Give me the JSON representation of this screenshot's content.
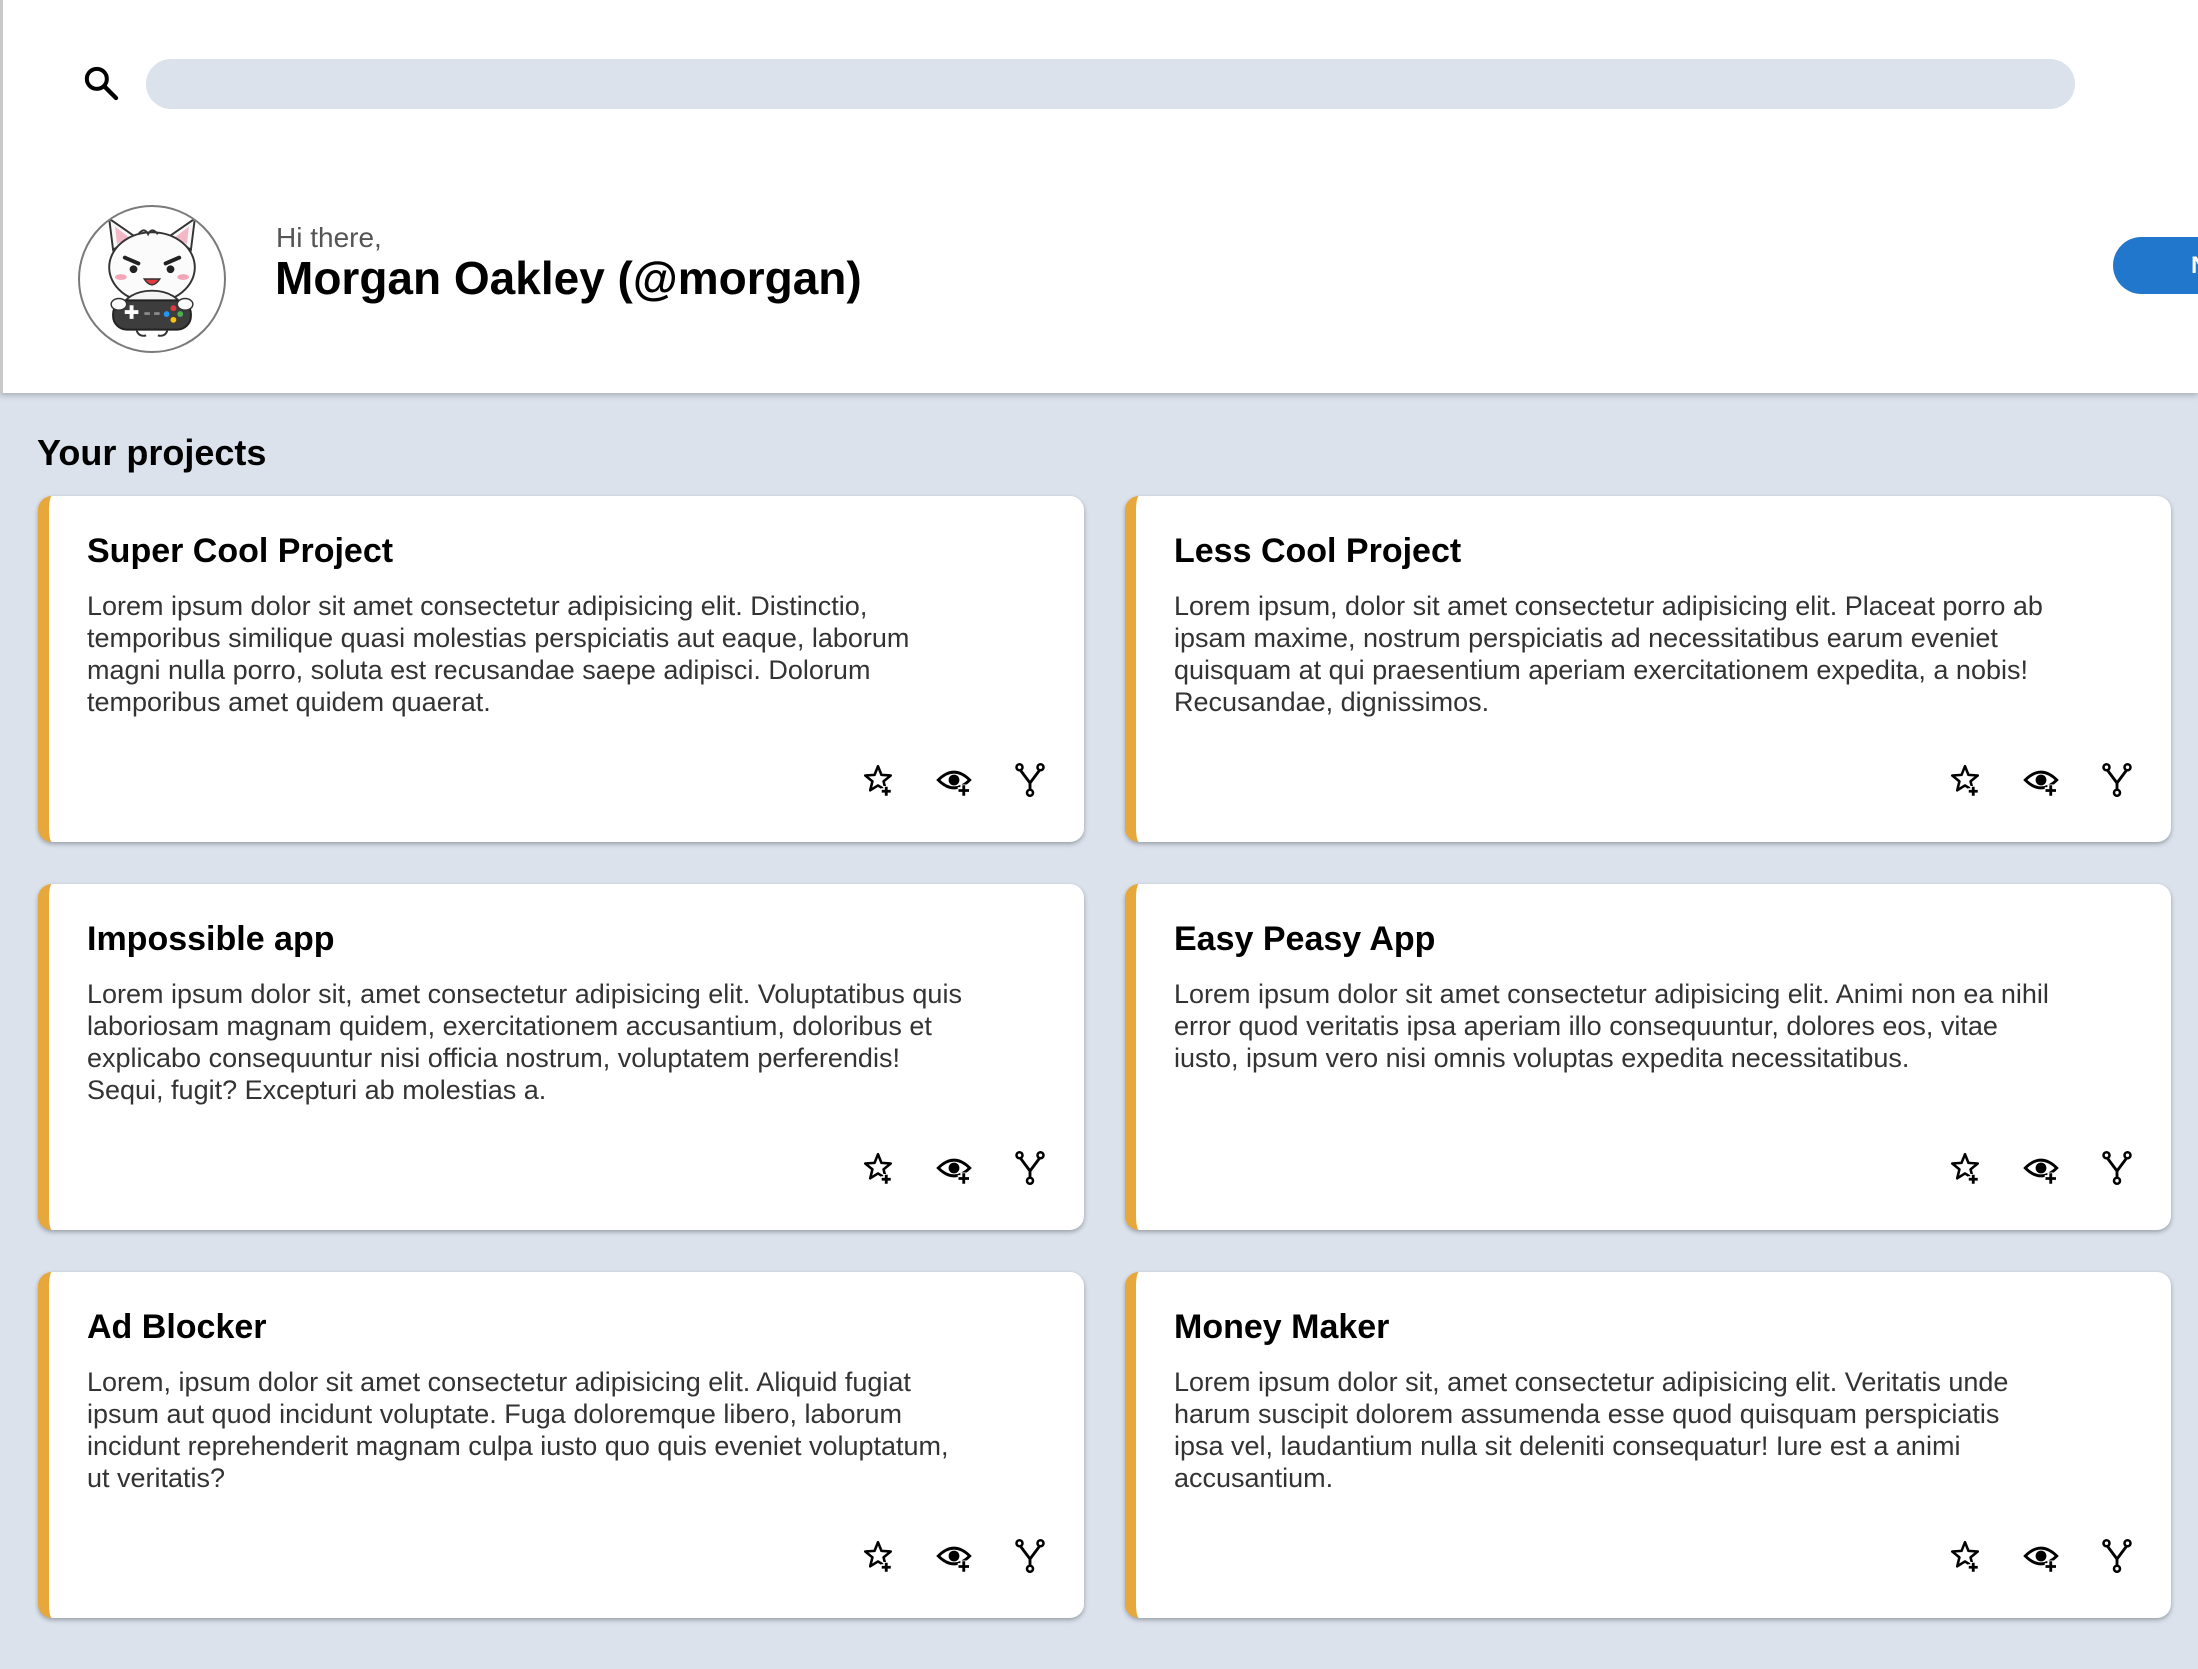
{
  "search": {
    "placeholder": "",
    "value": ""
  },
  "profile": {
    "greeting": "Hi there,",
    "name": "Morgan Oakley (@morgan)"
  },
  "header": {
    "button_label": "N"
  },
  "projects_heading": "Your projects",
  "colors": {
    "accent": "#e8a73a",
    "page_bg": "#dbe2ec",
    "button_blue": "#2177cc"
  },
  "icons": [
    "search-icon",
    "star-plus-icon",
    "eye-plus-icon",
    "fork-icon"
  ],
  "projects": [
    {
      "title": "Super Cool Project",
      "description": "Lorem ipsum dolor sit amet consectetur adipisicing elit. Distinctio, temporibus similique quasi molestias perspiciatis aut eaque, laborum magni nulla porro, soluta est recusandae saepe adipisci. Dolorum temporibus amet quidem quaerat."
    },
    {
      "title": "Less Cool Project",
      "description": "Lorem ipsum, dolor sit amet consectetur adipisicing elit. Placeat porro ab ipsam maxime, nostrum perspiciatis ad necessitatibus earum eveniet quisquam at qui praesentium aperiam exercitationem expedita, a nobis! Recusandae, dignissimos."
    },
    {
      "title": "Impossible app",
      "description": "Lorem ipsum dolor sit, amet consectetur adipisicing elit. Voluptatibus quis laboriosam magnam quidem, exercitationem accusantium, doloribus et explicabo consequuntur nisi officia nostrum, voluptatem perferendis! Sequi, fugit? Excepturi ab molestias a."
    },
    {
      "title": "Easy Peasy App",
      "description": "Lorem ipsum dolor sit amet consectetur adipisicing elit. Animi non ea nihil error quod veritatis ipsa aperiam illo consequuntur, dolores eos, vitae iusto, ipsum vero nisi omnis voluptas expedita necessitatibus."
    },
    {
      "title": "Ad Blocker",
      "description": "Lorem, ipsum dolor sit amet consectetur adipisicing elit. Aliquid fugiat ipsum aut quod incidunt voluptate. Fuga doloremque libero, laborum incidunt reprehenderit magnam culpa iusto quo quis eveniet voluptatum, ut veritatis?"
    },
    {
      "title": "Money Maker",
      "description": "Lorem ipsum dolor sit, amet consectetur adipisicing elit. Veritatis unde harum suscipit dolorem assumenda esse quod quisquam perspiciatis ipsa vel, laudantium nulla sit deleniti consequatur! Iure est a animi accusantium."
    }
  ]
}
